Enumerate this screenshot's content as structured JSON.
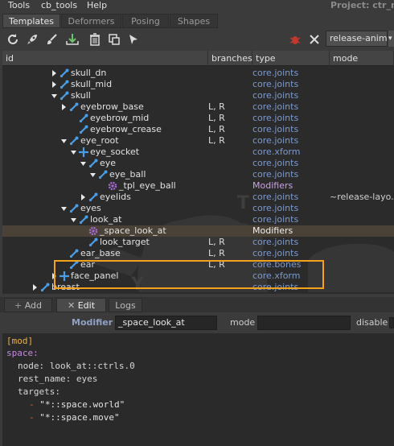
{
  "menu": {
    "items": [
      "Tools",
      "cb_tools",
      "Help"
    ],
    "project": "Project: ctr_may"
  },
  "tabs": [
    "Templates",
    "Deformers",
    "Posing",
    "Shapes"
  ],
  "toolbar": {
    "anim_layer": "release-anim",
    "icons": [
      "refresh-icon",
      "rocket-icon",
      "brush-icon",
      "import-icon",
      "trash-icon",
      "copy-icon",
      "pointer-icon",
      "bug-icon",
      "tools-icon"
    ]
  },
  "tree": {
    "columns": [
      "id",
      "branches",
      "type",
      "mode"
    ],
    "rows": [
      {
        "name": "skull_dn",
        "branches": "",
        "type": "core.joints",
        "mode": ""
      },
      {
        "name": "skull_mid",
        "branches": "",
        "type": "core.joints",
        "mode": ""
      },
      {
        "name": "skull",
        "branches": "",
        "type": "core.joints",
        "mode": ""
      },
      {
        "name": "eyebrow_base",
        "branches": "L, R",
        "type": "core.joints",
        "mode": ""
      },
      {
        "name": "eyebrow_mid",
        "branches": "L, R",
        "type": "core.joints",
        "mode": ""
      },
      {
        "name": "eyebrow_crease",
        "branches": "L, R",
        "type": "core.joints",
        "mode": ""
      },
      {
        "name": "eye_root",
        "branches": "L, R",
        "type": "core.joints",
        "mode": ""
      },
      {
        "name": "eye_socket",
        "branches": "",
        "type": "core.xform",
        "mode": ""
      },
      {
        "name": "eye",
        "branches": "",
        "type": "core.joints",
        "mode": ""
      },
      {
        "name": "eye_ball",
        "branches": "",
        "type": "core.joints",
        "mode": ""
      },
      {
        "name": "_tpl_eye_ball",
        "branches": "",
        "type": "Modifiers",
        "mode": ""
      },
      {
        "name": "eyelids",
        "branches": "",
        "type": "core.joints",
        "mode": "~release-layo..."
      },
      {
        "name": "eyes",
        "branches": "",
        "type": "core.joints",
        "mode": ""
      },
      {
        "name": "look_at",
        "branches": "",
        "type": "core.joints",
        "mode": ""
      },
      {
        "name": "_space_look_at",
        "branches": "",
        "type": "Modifiers",
        "mode": ""
      },
      {
        "name": "look_target",
        "branches": "L, R",
        "type": "core.joints",
        "mode": ""
      },
      {
        "name": "ear_base",
        "branches": "L, R",
        "type": "core.joints",
        "mode": ""
      },
      {
        "name": "ear",
        "branches": "L, R",
        "type": "core.bones",
        "mode": ""
      },
      {
        "name": "face_panel",
        "branches": "",
        "type": "core.xform",
        "mode": ""
      },
      {
        "name": "breast",
        "branches": "",
        "type": "core.joints",
        "mode": ""
      }
    ]
  },
  "bottom_tabs": [
    "Add",
    "Edit",
    "Logs"
  ],
  "modifier": {
    "label": "Modifier",
    "name": "_space_look_at",
    "mode_label": "mode",
    "mode_value": "",
    "disable_label": "disable"
  },
  "editor": {
    "lines": [
      "[mod]",
      "space:",
      "node: look_at::ctrls.0",
      "rest_name: eyes",
      "targets:",
      "\"*::space.world\"",
      "\"*::space.move\""
    ],
    "keys": [
      "space",
      "node",
      "rest_name",
      "targets"
    ]
  },
  "colors": {
    "accent": "#f2a31b",
    "type_text": "#7a9ad0",
    "modifier_text": "#cda0e6",
    "joint_icon": "#4a9ee8"
  }
}
